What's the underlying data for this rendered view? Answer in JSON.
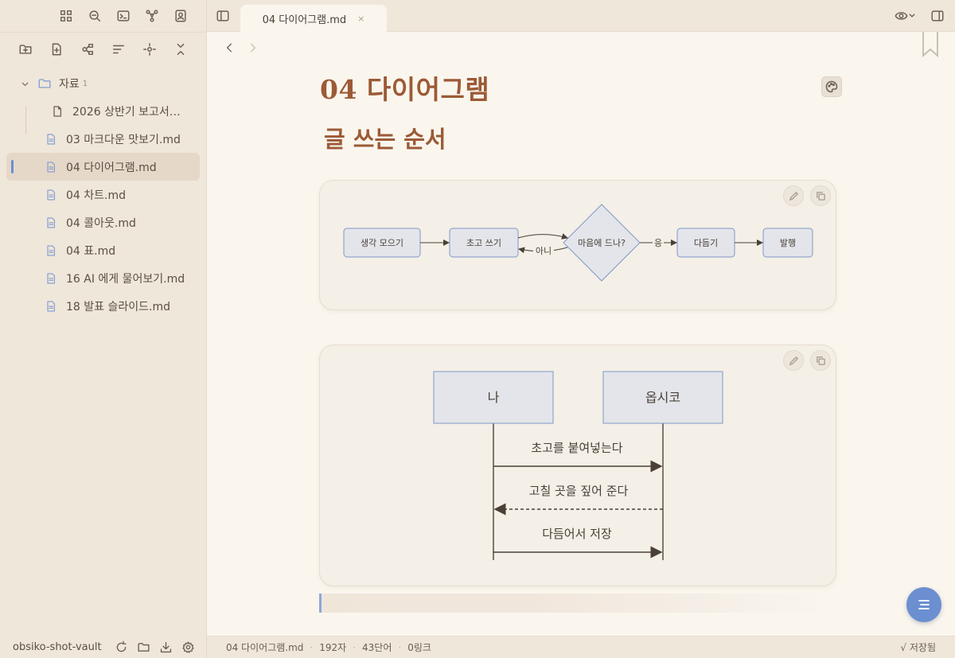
{
  "sidebar": {
    "folder": {
      "name": "자료",
      "count": "1"
    },
    "files": [
      {
        "name": "2026 상반기 보고서…",
        "nested": true,
        "active": false
      },
      {
        "name": "03 마크다운 맛보기.md",
        "nested": false,
        "active": false
      },
      {
        "name": "04 다이어그램.md",
        "nested": false,
        "active": true
      },
      {
        "name": "04 차트.md",
        "nested": false,
        "active": false
      },
      {
        "name": "04 콜아웃.md",
        "nested": false,
        "active": false
      },
      {
        "name": "04 표.md",
        "nested": false,
        "active": false
      },
      {
        "name": "16 AI 에게 물어보기.md",
        "nested": false,
        "active": false
      },
      {
        "name": "18 발표 슬라이드.md",
        "nested": false,
        "active": false
      }
    ],
    "vault_name": "obsiko-shot-vault"
  },
  "tab": {
    "title": "04 다이어그램.md",
    "close": "×"
  },
  "document": {
    "title": "04 다이어그램",
    "heading": "글 쓰는 순서"
  },
  "flowchart": {
    "nodes": [
      "생각 모으기",
      "초고 쓰기",
      "마음에 드나?",
      "다듬기",
      "발행"
    ],
    "edge_no": "아니",
    "edge_yes": "응"
  },
  "sequence": {
    "actors": [
      "나",
      "옵시코"
    ],
    "messages": [
      "초고를 붙여넣는다",
      "고칠 곳을 짚어 준다",
      "다듬어서 저장"
    ]
  },
  "statusbar": {
    "filename": "04 다이어그램.md",
    "chars": "192자",
    "words": "43단어",
    "links": "0링크",
    "saved": "√ 저장됨"
  },
  "colors": {
    "accent": "#9c5a36",
    "node_fill": "#e3e5ea",
    "node_stroke": "#7f98c7",
    "toc_button": "#6b8fd0"
  }
}
